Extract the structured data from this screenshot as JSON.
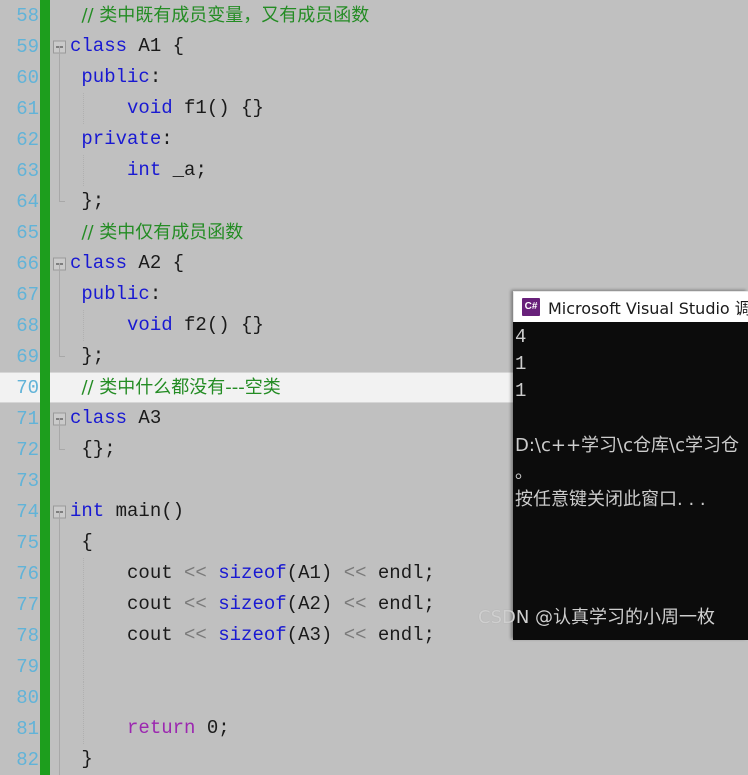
{
  "editor": {
    "first_visible_line": 58,
    "current_line": 70,
    "lines": [
      {
        "no": "58",
        "fold": "none",
        "guide": false,
        "tokens": [
          {
            "t": "  // 类中既有成员变量，又有成员函数",
            "c": "tok-comment",
            "cjk": true
          }
        ]
      },
      {
        "no": "59",
        "fold": "box",
        "guide": false,
        "tokens": [
          {
            "t": "class",
            "c": "tok-kw"
          },
          {
            "t": " A1 {",
            "c": "tok-plain"
          }
        ]
      },
      {
        "no": "60",
        "fold": "line",
        "guide": false,
        "tokens": [
          {
            "t": " ",
            "c": "tok-plain"
          },
          {
            "t": "public",
            "c": "tok-kw"
          },
          {
            "t": ":",
            "c": "tok-plain"
          }
        ]
      },
      {
        "no": "61",
        "fold": "line",
        "guide": true,
        "tokens": [
          {
            "t": "     ",
            "c": "tok-plain"
          },
          {
            "t": "void",
            "c": "tok-kw"
          },
          {
            "t": " f1() {}",
            "c": "tok-plain"
          }
        ]
      },
      {
        "no": "62",
        "fold": "line",
        "guide": false,
        "tokens": [
          {
            "t": " ",
            "c": "tok-plain"
          },
          {
            "t": "private",
            "c": "tok-kw"
          },
          {
            "t": ":",
            "c": "tok-plain"
          }
        ]
      },
      {
        "no": "63",
        "fold": "line",
        "guide": true,
        "tokens": [
          {
            "t": "     ",
            "c": "tok-plain"
          },
          {
            "t": "int",
            "c": "tok-kw"
          },
          {
            "t": " _a;",
            "c": "tok-plain"
          }
        ]
      },
      {
        "no": "64",
        "fold": "endcap",
        "guide": false,
        "tokens": [
          {
            "t": " };",
            "c": "tok-plain"
          }
        ]
      },
      {
        "no": "65",
        "fold": "none",
        "guide": false,
        "tokens": [
          {
            "t": "  // 类中仅有成员函数",
            "c": "tok-comment",
            "cjk": true
          }
        ]
      },
      {
        "no": "66",
        "fold": "box",
        "guide": false,
        "tokens": [
          {
            "t": "class",
            "c": "tok-kw"
          },
          {
            "t": " A2 {",
            "c": "tok-plain"
          }
        ]
      },
      {
        "no": "67",
        "fold": "line",
        "guide": false,
        "tokens": [
          {
            "t": " ",
            "c": "tok-plain"
          },
          {
            "t": "public",
            "c": "tok-kw"
          },
          {
            "t": ":",
            "c": "tok-plain"
          }
        ]
      },
      {
        "no": "68",
        "fold": "line",
        "guide": true,
        "tokens": [
          {
            "t": "     ",
            "c": "tok-plain"
          },
          {
            "t": "void",
            "c": "tok-kw"
          },
          {
            "t": " f2() {}",
            "c": "tok-plain"
          }
        ]
      },
      {
        "no": "69",
        "fold": "endcap",
        "guide": false,
        "tokens": [
          {
            "t": " };",
            "c": "tok-plain"
          }
        ]
      },
      {
        "no": "70",
        "fold": "none",
        "guide": false,
        "tokens": [
          {
            "t": "  // 类中什么都没有---空类",
            "c": "tok-comment",
            "cjk": true
          }
        ]
      },
      {
        "no": "71",
        "fold": "box",
        "guide": false,
        "tokens": [
          {
            "t": "class",
            "c": "tok-kw"
          },
          {
            "t": " A3",
            "c": "tok-plain"
          }
        ]
      },
      {
        "no": "72",
        "fold": "endcap",
        "guide": false,
        "tokens": [
          {
            "t": " {};",
            "c": "tok-plain"
          }
        ]
      },
      {
        "no": "73",
        "fold": "none",
        "guide": false,
        "tokens": [
          {
            "t": "",
            "c": "tok-plain"
          }
        ]
      },
      {
        "no": "74",
        "fold": "box",
        "guide": false,
        "tokens": [
          {
            "t": "int",
            "c": "tok-kw"
          },
          {
            "t": " main()",
            "c": "tok-plain"
          }
        ]
      },
      {
        "no": "75",
        "fold": "line",
        "guide": false,
        "tokens": [
          {
            "t": " {",
            "c": "tok-plain"
          }
        ]
      },
      {
        "no": "76",
        "fold": "line",
        "guide": true,
        "tokens": [
          {
            "t": "     cout ",
            "c": "tok-plain"
          },
          {
            "t": "<<",
            "c": "tok-op"
          },
          {
            "t": " ",
            "c": "tok-plain"
          },
          {
            "t": "sizeof",
            "c": "tok-kw"
          },
          {
            "t": "(A1) ",
            "c": "tok-plain"
          },
          {
            "t": "<<",
            "c": "tok-op"
          },
          {
            "t": " endl;",
            "c": "tok-plain"
          }
        ]
      },
      {
        "no": "77",
        "fold": "line",
        "guide": true,
        "tokens": [
          {
            "t": "     cout ",
            "c": "tok-plain"
          },
          {
            "t": "<<",
            "c": "tok-op"
          },
          {
            "t": " ",
            "c": "tok-plain"
          },
          {
            "t": "sizeof",
            "c": "tok-kw"
          },
          {
            "t": "(A2) ",
            "c": "tok-plain"
          },
          {
            "t": "<<",
            "c": "tok-op"
          },
          {
            "t": " endl;",
            "c": "tok-plain"
          }
        ]
      },
      {
        "no": "78",
        "fold": "line",
        "guide": true,
        "tokens": [
          {
            "t": "     cout ",
            "c": "tok-plain"
          },
          {
            "t": "<<",
            "c": "tok-op"
          },
          {
            "t": " ",
            "c": "tok-plain"
          },
          {
            "t": "sizeof",
            "c": "tok-kw"
          },
          {
            "t": "(A3) ",
            "c": "tok-plain"
          },
          {
            "t": "<<",
            "c": "tok-op"
          },
          {
            "t": " endl;",
            "c": "tok-plain"
          }
        ]
      },
      {
        "no": "79",
        "fold": "line",
        "guide": true,
        "tokens": [
          {
            "t": "",
            "c": "tok-plain"
          }
        ]
      },
      {
        "no": "80",
        "fold": "line",
        "guide": true,
        "tokens": [
          {
            "t": "",
            "c": "tok-plain"
          }
        ]
      },
      {
        "no": "81",
        "fold": "line",
        "guide": true,
        "tokens": [
          {
            "t": "     ",
            "c": "tok-plain"
          },
          {
            "t": "return",
            "c": "tok-kw2"
          },
          {
            "t": " 0;",
            "c": "tok-plain"
          }
        ]
      },
      {
        "no": "82",
        "fold": "line",
        "guide": false,
        "tokens": [
          {
            "t": " }",
            "c": "tok-plain"
          }
        ]
      }
    ]
  },
  "console": {
    "icon_label": "C#",
    "title": "Microsoft Visual Studio 调试",
    "lines": [
      {
        "text": "4",
        "cjk": false
      },
      {
        "text": "1",
        "cjk": false
      },
      {
        "text": "1",
        "cjk": false
      },
      {
        "text": "",
        "cjk": false
      },
      {
        "text": "D:\\c++学习\\c仓库\\c学习仓",
        "cjk": true
      },
      {
        "text": "。",
        "cjk": true
      },
      {
        "text": "按任意键关闭此窗口. . .",
        "cjk": true
      }
    ]
  },
  "watermark": {
    "text": "CSDN @认真学习的小周一枚"
  },
  "colors": {
    "editor_bg": "#c0c0c0",
    "current_line_bg": "#f2f2f2",
    "changebar_green": "#1d9e1d",
    "lineno_blue": "#61b3d8",
    "keyword_blue": "#1919d2",
    "comment_green": "#248c24",
    "return_purple": "#9c27b0",
    "console_bg": "#0c0c0c",
    "console_fg": "#cccccc",
    "vs_icon_purple": "#68217a"
  }
}
